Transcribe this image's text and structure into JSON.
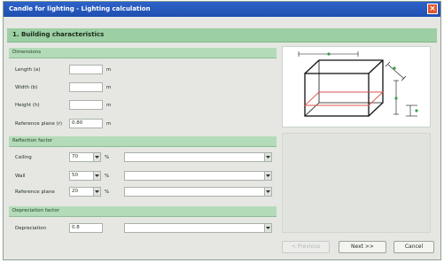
{
  "window": {
    "title": "Candle for lighting - Lighting calculation",
    "close_glyph": "×"
  },
  "header": {
    "title": "1. Building characteristics"
  },
  "dimensions": {
    "section_label": "Dimensions",
    "length": {
      "label": "Length (a)",
      "value": "",
      "unit": "m"
    },
    "width": {
      "label": "Width (b)",
      "value": "",
      "unit": "m"
    },
    "height": {
      "label": "Height (h)",
      "value": "",
      "unit": "m"
    },
    "reference_plane": {
      "label": "Reference plane (r)",
      "value": "0.80",
      "unit": "m"
    }
  },
  "reflection": {
    "section_label": "Reflection factor",
    "ceiling": {
      "label": "Ceiling",
      "value": "70",
      "unit": "%",
      "description": ""
    },
    "wall": {
      "label": "Wall",
      "value": "50",
      "unit": "%",
      "description": ""
    },
    "reference_plane": {
      "label": "Reference plane",
      "value": "20",
      "unit": "%",
      "description": ""
    }
  },
  "depreciation": {
    "section_label": "Depreciation factor",
    "depreciation": {
      "label": "Depreciation",
      "value": "0.8",
      "description": ""
    }
  },
  "buttons": {
    "back": "< Previous",
    "next": "Next >>",
    "cancel": "Cancel"
  },
  "diagram": {
    "icon": "room-dimensions-diagram",
    "accent": "#3aa04a",
    "edge_color": "#111111",
    "plane_color": "#d9534f"
  }
}
